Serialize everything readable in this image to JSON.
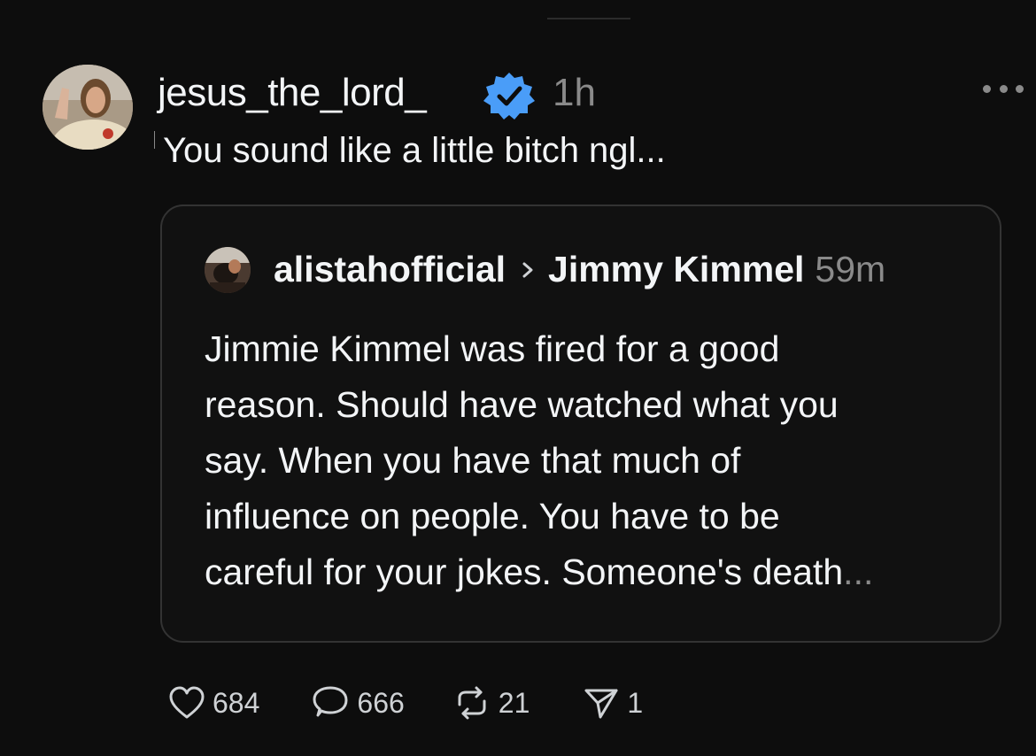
{
  "post": {
    "username": "jesus_the_lord_",
    "timestamp": "1h",
    "text": "You sound like a little bitch ngl...",
    "verified_icon": "verified-badge-icon",
    "accent_color": "#4a9df8"
  },
  "quoted_post": {
    "username": "alistahofficial",
    "reply_to": "Jimmy Kimmel",
    "timestamp": "59m",
    "body_lines": [
      "Jimmie Kimmel was fired for a good",
      "reason. Should have watched what you",
      "say. When you have that much of",
      "influence on people. You have to be",
      "careful for your jokes. Someone's death"
    ],
    "truncation": "..."
  },
  "actions": {
    "likes": "684",
    "replies": "666",
    "reposts": "21",
    "shares": "1"
  }
}
